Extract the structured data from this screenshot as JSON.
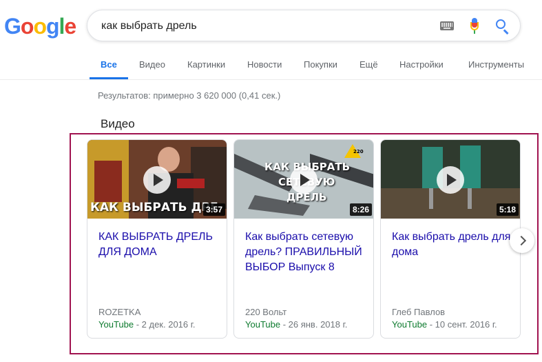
{
  "logo": {
    "letters": [
      "G",
      "o",
      "o",
      "g",
      "l",
      "e"
    ],
    "colors": [
      "#4285f4",
      "#ea4335",
      "#fbbc05",
      "#4285f4",
      "#34a853",
      "#ea4335"
    ]
  },
  "search": {
    "query": "как выбрать дрель"
  },
  "tabs": [
    {
      "label": "Все",
      "active": true
    },
    {
      "label": "Видео"
    },
    {
      "label": "Картинки"
    },
    {
      "label": "Новости"
    },
    {
      "label": "Покупки"
    },
    {
      "label": "Ещё"
    },
    {
      "label": "Настройки"
    },
    {
      "label": "Инструменты"
    }
  ],
  "results_stats": "Результатов: примерно 3 620 000 (0,41 сек.)",
  "section_title": "Видео",
  "videos": [
    {
      "title": "КАК ВЫБРАТЬ ДРЕЛЬ ДЛЯ ДОМА",
      "duration": "3:57",
      "channel": "ROZETKA",
      "source": "YouTube",
      "date": " - 2 дек. 2016 г.",
      "thumb_text": "КАК ВЫБРАТЬ ДРЕ"
    },
    {
      "title": "Как выбрать сетевую дрель? ПРАВИЛЬНЫЙ ВЫБОР Выпуск 8",
      "duration": "8:26",
      "channel": "220 Вольт",
      "source": "YouTube",
      "date": " - 26 янв. 2018 г.",
      "thumb_text_1": "КАК ВЫБРАТЬ",
      "thumb_text_2": "СЕТЕВУЮ",
      "thumb_text_3": "ДРЕЛЬ",
      "badge": "220"
    },
    {
      "title": "Как выбрать дрель для дома",
      "duration": "5:18",
      "channel": "Глеб Павлов",
      "source": "YouTube",
      "date": " - 10 сент. 2016 г."
    }
  ]
}
